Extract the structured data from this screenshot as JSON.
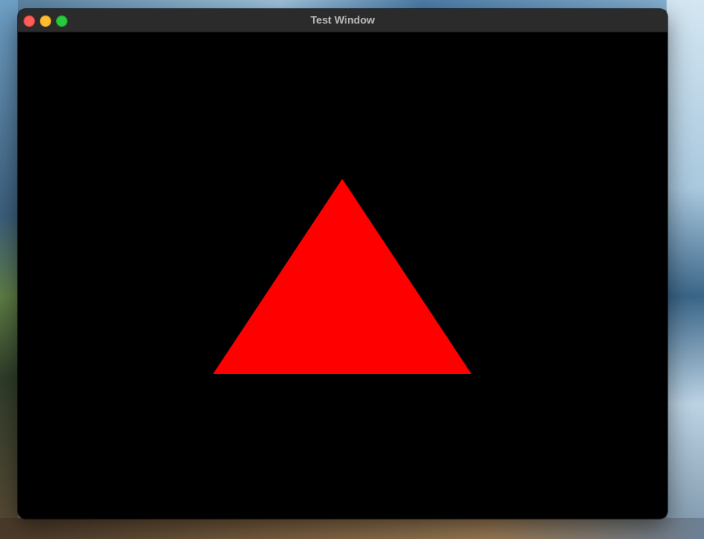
{
  "window": {
    "title": "Test Window",
    "content_background": "#000000"
  },
  "traffic_lights": {
    "close_color": "#ff5f57",
    "minimize_color": "#febc2e",
    "zoom_color": "#28c840"
  },
  "render": {
    "shape": "triangle",
    "fill_color": "#ff0000"
  }
}
